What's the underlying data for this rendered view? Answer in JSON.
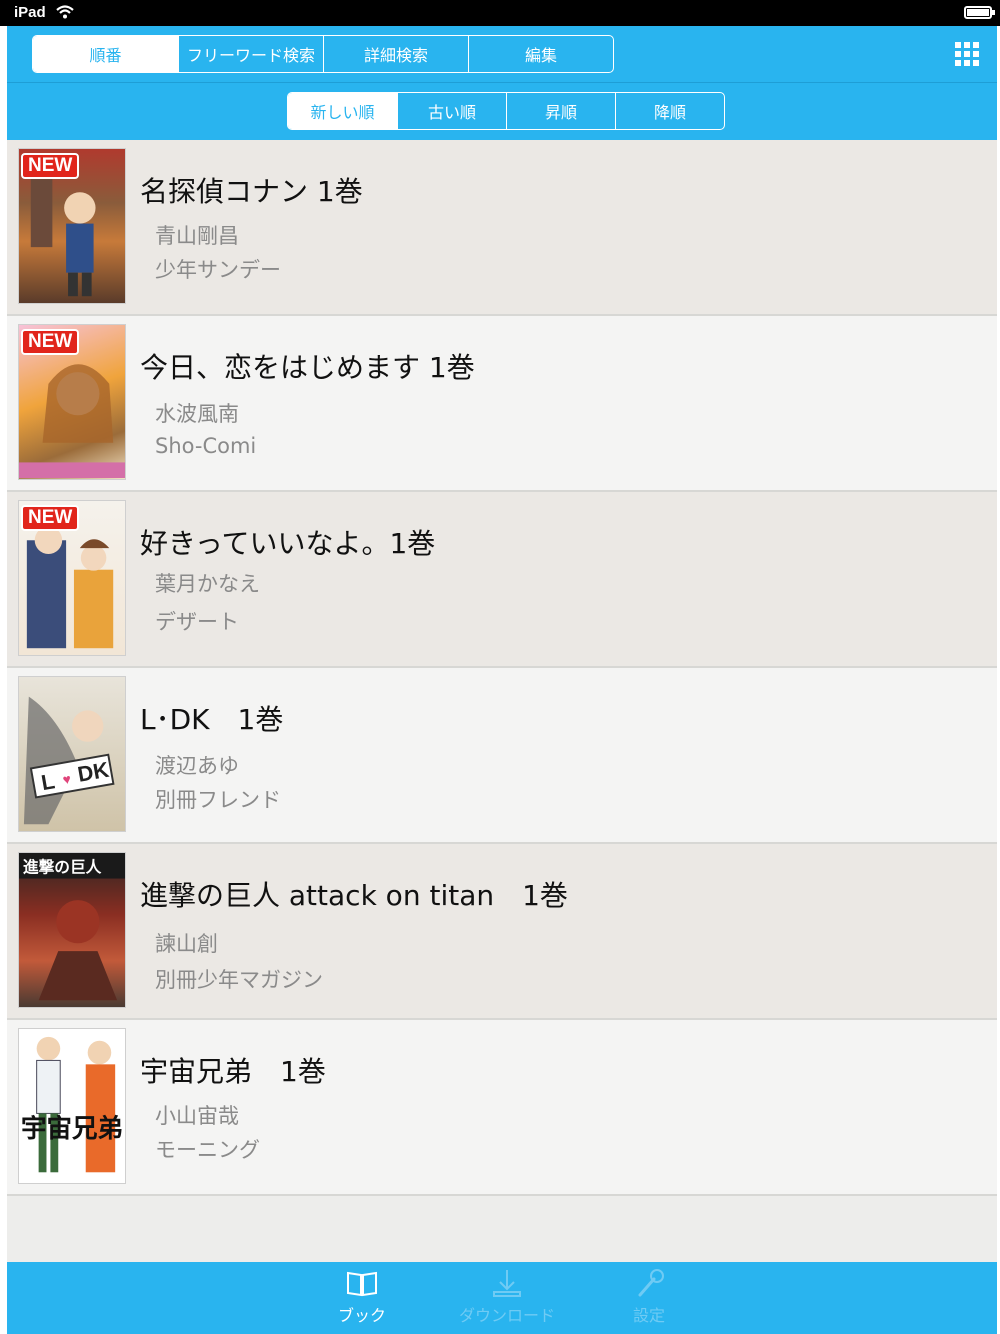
{
  "status_bar": {
    "carrier": "iPad"
  },
  "main_segments": [
    "順番",
    "フリーワード検索",
    "詳細検索",
    "編集"
  ],
  "sort_segments": [
    "新しい順",
    "古い順",
    "昇順",
    "降順"
  ],
  "new_badge_label": "NEW",
  "books": [
    {
      "title": "名探偵コナン 1巻",
      "author": "青山剛昌",
      "magazine": "少年サンデー",
      "is_new": true
    },
    {
      "title": "今日、恋をはじめます 1巻",
      "author": "水波風南",
      "magazine": "Sho-Comi",
      "is_new": true
    },
    {
      "title": "好きっていいなよ。1巻",
      "author": "葉月かなえ",
      "magazine": "デザート",
      "is_new": true
    },
    {
      "title": "L･DK　1巻",
      "author": "渡辺あゆ",
      "magazine": "別冊フレンド",
      "is_new": false
    },
    {
      "title": "進撃の巨人 attack on titan　1巻",
      "author": "諫山創",
      "magazine": "別冊少年マガジン",
      "is_new": false
    },
    {
      "title": "宇宙兄弟　1巻",
      "author": "小山宙哉",
      "magazine": "モーニング",
      "is_new": false
    }
  ],
  "tabs": [
    {
      "label": "ブック",
      "icon": "book-icon",
      "active": true
    },
    {
      "label": "ダウンロード",
      "icon": "download-icon",
      "active": false
    },
    {
      "label": "設定",
      "icon": "wrench-icon",
      "active": false
    }
  ],
  "colors": {
    "accent": "#29b4ef",
    "new_badge": "#e1251b"
  }
}
